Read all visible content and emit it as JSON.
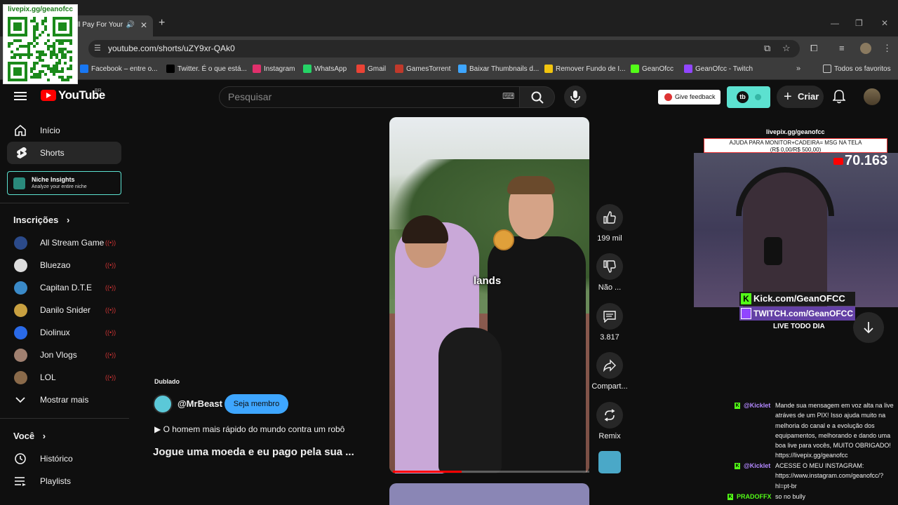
{
  "browser": {
    "tab_title": "ll Pay For Your",
    "url": "youtube.com/shorts/uZY9xr-QAk0",
    "bookmarks": [
      {
        "label": "Facebook – entre o...",
        "icon": "facebook-icon",
        "color": "#1877f2"
      },
      {
        "label": "Twitter. É o que está...",
        "icon": "x-icon",
        "color": "#000000"
      },
      {
        "label": "Instagram",
        "icon": "instagram-icon",
        "color": "#e1306c"
      },
      {
        "label": "WhatsApp",
        "icon": "whatsapp-icon",
        "color": "#25d366"
      },
      {
        "label": "Gmail",
        "icon": "gmail-icon",
        "color": "#ea4335"
      },
      {
        "label": "GamesTorrent",
        "icon": "gamestorrent-icon",
        "color": "#c0392b"
      },
      {
        "label": "Baixar Thumbnails d...",
        "icon": "thumbnails-icon",
        "color": "#3ea6ff"
      },
      {
        "label": "Remover Fundo de I...",
        "icon": "remove-bg-icon",
        "color": "#f1c40f"
      },
      {
        "label": "GeanOfcc",
        "icon": "kick-icon",
        "color": "#53fc18"
      },
      {
        "label": "GeanOfcc - Twitch",
        "icon": "twitch-icon",
        "color": "#9146ff"
      }
    ],
    "all_bookmarks": "Todos os favoritos"
  },
  "overlay": {
    "qr_caption": "livepix.gg/geanofcc"
  },
  "youtube": {
    "logo_text": "YouTube",
    "country": "BR",
    "search_placeholder": "Pesquisar",
    "feedback": "Give feedback",
    "create": "Criar",
    "sidebar": {
      "home": "Início",
      "shorts": "Shorts",
      "niche_title": "Niche Insights",
      "niche_sub": "Analyze your entire niche",
      "subs_header": "Inscrições",
      "subscriptions": [
        {
          "name": "All Stream Game",
          "color": "#2b4a8a"
        },
        {
          "name": "Bluezao",
          "color": "#dddddd"
        },
        {
          "name": "Capitan D.T.E",
          "color": "#3a8ac8"
        },
        {
          "name": "Danilo Snider",
          "color": "#c8a040"
        },
        {
          "name": "Diolinux",
          "color": "#2a6ae8"
        },
        {
          "name": "Jon Vlogs",
          "color": "#a08070"
        },
        {
          "name": "LOL",
          "color": "#8a6a4a"
        }
      ],
      "show_more": "Mostrar mais",
      "you_header": "Você",
      "history": "Histórico",
      "playlists": "Playlists"
    },
    "short": {
      "caption": "lands",
      "progress": 0.35,
      "dubbed": "Dublado",
      "channel": "@MrBeast",
      "member_button": "Seja membro",
      "music": "▶ O homem mais rápido do mundo contra um robô",
      "title": "Jogue uma moeda e eu pago pela sua ..."
    },
    "actions": {
      "likes": "199 mil",
      "dislike": "Não ...",
      "comments": "3.817",
      "share": "Compart...",
      "remix": "Remix"
    }
  },
  "stream": {
    "url": "livepix.gg/geanofcc",
    "goal_line1": "AJUDA PARA MONITOR+CADEIRA= MSG NA TELA",
    "goal_line2": "(R$ 0,00/R$ 500,00)",
    "views": "70.163",
    "kick": "Kick.com/GeanOFCC",
    "twitch": "TWITCH.com/GeanOFCC",
    "live_text": "LIVE TODO DIA",
    "chat": [
      {
        "user": "@Kicklet",
        "user_color": "#b388ff",
        "message": "Mande sua mensagem em voz alta na live atráves de um PIX! Isso ajuda muito na melhoria do canal e a evolução dos equipamentos, melhorando e dando uma boa live para vocês, MUITO OBRIGADO! https://livepix.gg/geanofcc"
      },
      {
        "user": "@Kicklet",
        "user_color": "#b388ff",
        "message": "ACESSE O MEU INSTAGRAM: https://www.instagram.com/geanofcc/?hl=pt-br"
      },
      {
        "user": "PRADOFFX",
        "user_color": "#53fc18",
        "message": "so no bully"
      }
    ]
  }
}
